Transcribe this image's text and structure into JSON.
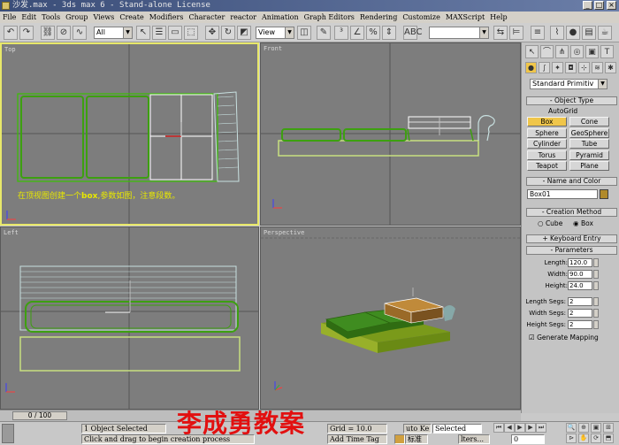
{
  "window": {
    "title": "沙发.max - 3ds max 6 - Stand-alone License",
    "minimize": "_",
    "maximize": "□",
    "close": "×"
  },
  "menu": [
    "File",
    "Edit",
    "Tools",
    "Group",
    "Views",
    "Create",
    "Modifiers",
    "Character",
    "reactor",
    "Animation",
    "Graph Editors",
    "Rendering",
    "Customize",
    "MAXScript",
    "Help"
  ],
  "toolbar": {
    "selection_filter": "All",
    "ref_coord": "View",
    "named_sel": ""
  },
  "viewports": {
    "top": {
      "label": "Top",
      "annotation_pre": "在顶视图创建一个",
      "annotation_bold": "box",
      "annotation_post": ",参数如图，注意段数。"
    },
    "front": {
      "label": "Front"
    },
    "left": {
      "label": "Left"
    },
    "perspective": {
      "label": "Perspective"
    }
  },
  "panel": {
    "category": "Standard Primitiv",
    "object_type": {
      "header": "Object Type",
      "autogrid": "AutoGrid",
      "buttons": [
        "Box",
        "Cone",
        "Sphere",
        "GeoSphere",
        "Cylinder",
        "Tube",
        "Torus",
        "Pyramid",
        "Teapot",
        "Plane"
      ]
    },
    "name_color": {
      "header": "Name and Color",
      "name": "Box01",
      "color": "#b08a2a"
    },
    "creation": {
      "header": "Creation Method",
      "opt_cube": "Cube",
      "opt_box": "Box"
    },
    "keyboard": {
      "header": "Keyboard Entry"
    },
    "parameters": {
      "header": "Parameters",
      "length_label": "Length:",
      "length": "120.0",
      "width_label": "Width:",
      "width": "90.0",
      "height_label": "Height:",
      "height": "24.0",
      "lsegs_label": "Length Segs:",
      "lsegs": "2",
      "wsegs_label": "Width Segs:",
      "wsegs": "2",
      "hsegs_label": "Height Segs:",
      "hsegs": "2",
      "genmap": "Generate Mapping"
    }
  },
  "timeline": {
    "frame": "0 / 100"
  },
  "status": {
    "selected": "1 Object Selected",
    "prompt": "Click and drag to begin creation process",
    "grid": "Grid = 10.0",
    "add_time_tag": "Add Time Tag",
    "auto_key": "uto Ke",
    "set_key": "标准",
    "key_mode": "Selected",
    "filters": "lters...",
    "frame_field": "0"
  },
  "watermark": "李成勇教案",
  "colors": {
    "active_border": "#e8e86a",
    "viewport_bg": "#7d7d7d",
    "selected_button": "#f0c64a",
    "sofa_green": "#3f8c20"
  }
}
